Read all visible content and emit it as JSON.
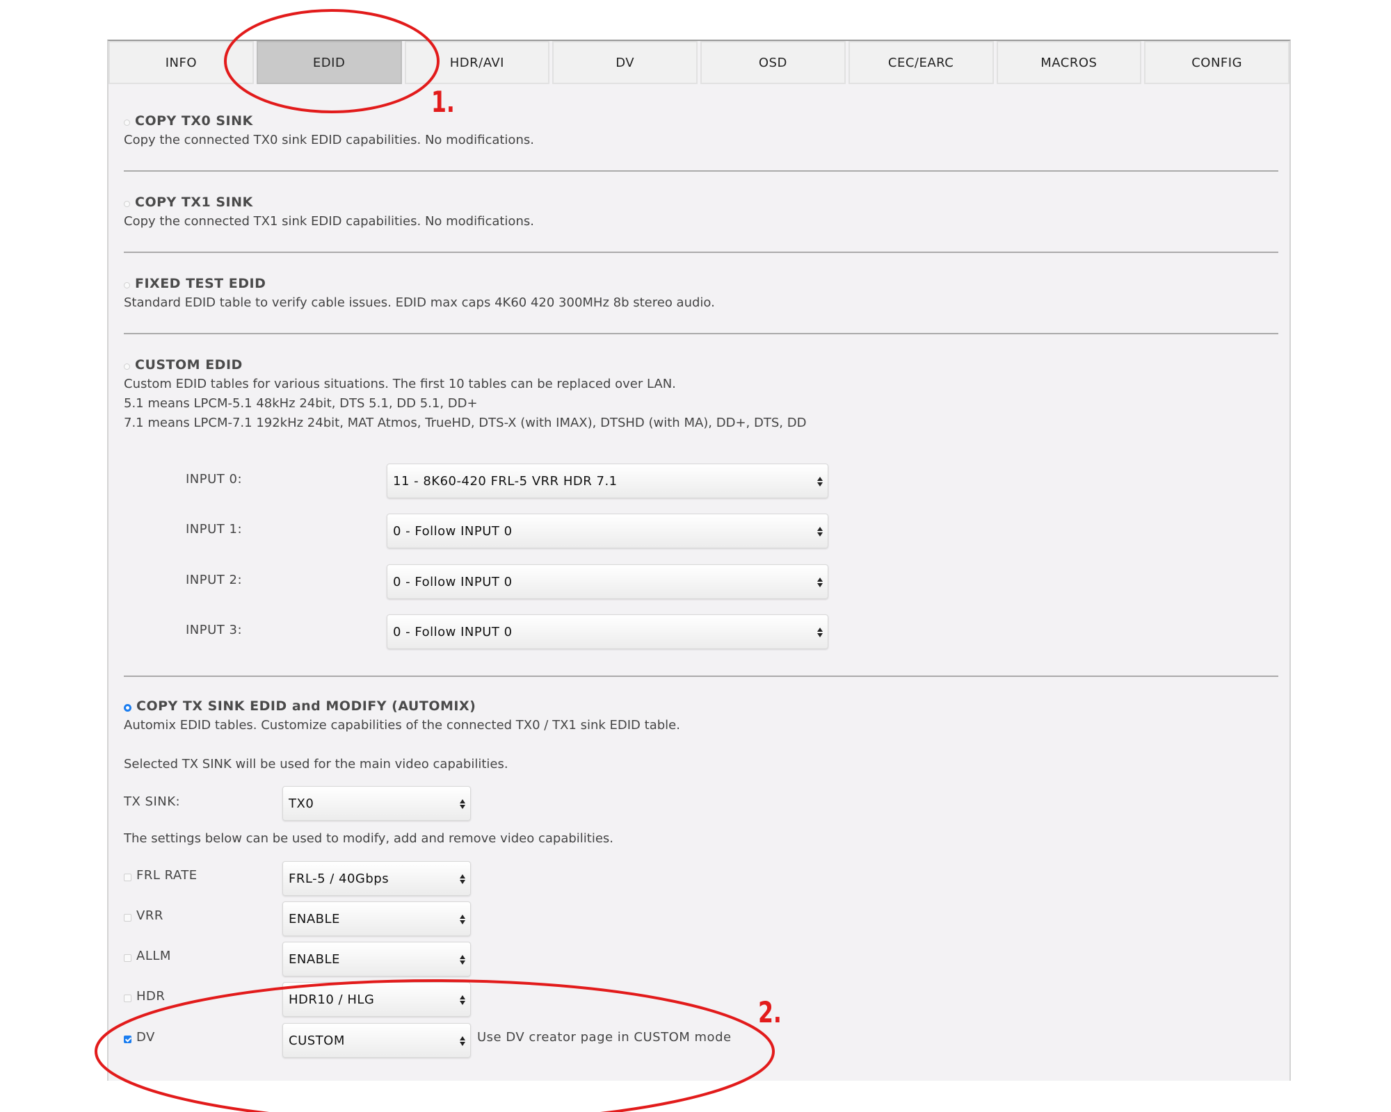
{
  "tabs": [
    {
      "label": "INFO"
    },
    {
      "label": "EDID",
      "active": true
    },
    {
      "label": "HDR/AVI"
    },
    {
      "label": "DV"
    },
    {
      "label": "OSD"
    },
    {
      "label": "CEC/EARC"
    },
    {
      "label": "MACROS"
    },
    {
      "label": "CONFIG"
    }
  ],
  "sections": {
    "copy_tx0": {
      "title": "COPY TX0 SINK",
      "desc": "Copy the connected TX0 sink EDID capabilities. No modifications.",
      "selected": false
    },
    "copy_tx1": {
      "title": "COPY TX1 SINK",
      "desc": "Copy the connected TX1 sink EDID capabilities. No modifications.",
      "selected": false
    },
    "fixed_test": {
      "title": "FIXED TEST EDID",
      "desc": "Standard EDID table to verify cable issues. EDID max caps 4K60 420 300MHz 8b stereo audio.",
      "selected": false
    },
    "custom": {
      "title": "CUSTOM EDID",
      "desc_lines": [
        "Custom EDID tables for various situations. The first 10 tables can be replaced over LAN.",
        "5.1 means LPCM-5.1 48kHz 24bit, DTS 5.1, DD 5.1, DD+",
        "7.1 means LPCM-7.1 192kHz 24bit, MAT Atmos, TrueHD, DTS-X (with IMAX), DTSHD (with MA), DD+, DTS, DD"
      ],
      "selected": false,
      "inputs": [
        {
          "label": "INPUT 0:",
          "value": "11 - 8K60-420 FRL-5 VRR HDR 7.1"
        },
        {
          "label": "INPUT 1:",
          "value": "0 - Follow INPUT 0"
        },
        {
          "label": "INPUT 2:",
          "value": "0 - Follow INPUT 0"
        },
        {
          "label": "INPUT 3:",
          "value": "0 - Follow INPUT 0"
        }
      ]
    },
    "automix": {
      "title": "COPY TX SINK EDID and MODIFY (AUTOMIX)",
      "desc": "Automix EDID tables. Customize capabilities of the connected TX0 / TX1 sink EDID table.",
      "selected": true,
      "sink_note": "Selected TX SINK will be used for the main video capabilities.",
      "tx_sink_label": "TX SINK:",
      "tx_sink_value": "TX0",
      "settings_note": "The settings below can be used to modify, add and remove video capabilities.",
      "options": [
        {
          "label": "FRL RATE",
          "value": "FRL-5 / 40Gbps",
          "checked": false
        },
        {
          "label": "VRR",
          "value": "ENABLE",
          "checked": false
        },
        {
          "label": "ALLM",
          "value": "ENABLE",
          "checked": false
        },
        {
          "label": "HDR",
          "value": "HDR10 / HLG",
          "checked": false
        },
        {
          "label": "DV",
          "value": "CUSTOM",
          "checked": true,
          "note": "Use DV creator page in CUSTOM mode"
        }
      ]
    }
  },
  "annotations": {
    "num1": "1.",
    "num2": "2.",
    "color": "#e21b1b"
  },
  "colors": {
    "accent": "#1a7df0",
    "active_tab": "#c9c9c9",
    "panel_bg": "#f3f2f4"
  }
}
